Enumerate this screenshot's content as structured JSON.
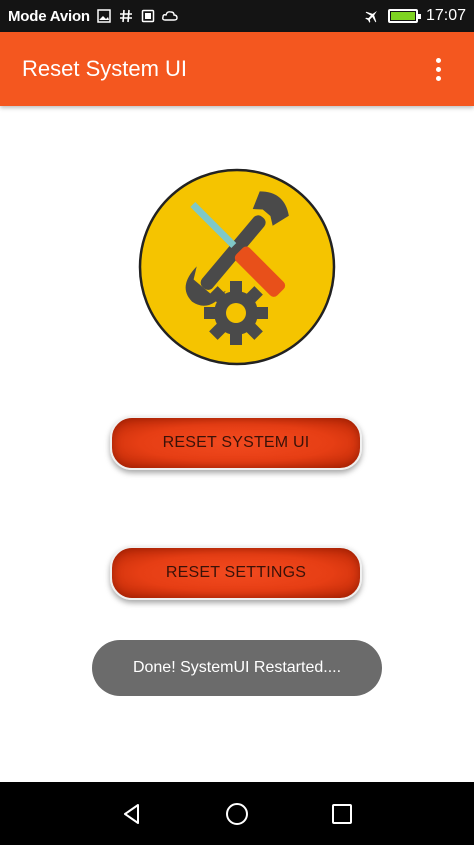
{
  "status_bar": {
    "carrier": "Mode Avion",
    "time": "17:07",
    "icons": [
      "image-icon",
      "hash-icon",
      "sim-icon",
      "cloud-icon",
      "airplane-icon",
      "battery-icon"
    ]
  },
  "app_bar": {
    "title": "Reset System UI",
    "menu_icon": "overflow-menu-icon"
  },
  "logo": {
    "icon": "tools-gear-icon",
    "circle_color": "#f5c400",
    "tool_color": "#4a4a4a",
    "handle_color": "#e8501a"
  },
  "buttons": {
    "reset_system_ui": "RESET SYSTEM UI",
    "reset_settings": "RESET SETTINGS"
  },
  "toast": {
    "message": "Done! SystemUI Restarted...."
  },
  "nav_bar": {
    "icons": [
      "back-icon",
      "home-icon",
      "recents-icon"
    ]
  },
  "colors": {
    "accent": "#f4571f",
    "status_bar": "#141414",
    "button": "#e63e14",
    "toast": "#6b6b6b"
  }
}
